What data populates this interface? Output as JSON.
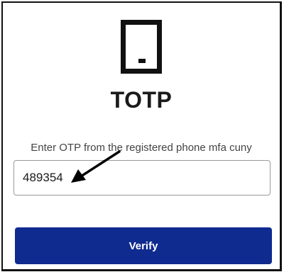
{
  "header": {
    "icon": "mobile-phone-icon",
    "title": "TOTP"
  },
  "form": {
    "otp_label": "Enter OTP from the registered phone mfa cuny",
    "otp_value": "489354",
    "verify_label": "Verify"
  },
  "annotation": {
    "icon": "arrow-icon"
  },
  "colors": {
    "primary_button": "#0f2b8f",
    "text": "#1a1a1a",
    "label_text": "#444444"
  }
}
